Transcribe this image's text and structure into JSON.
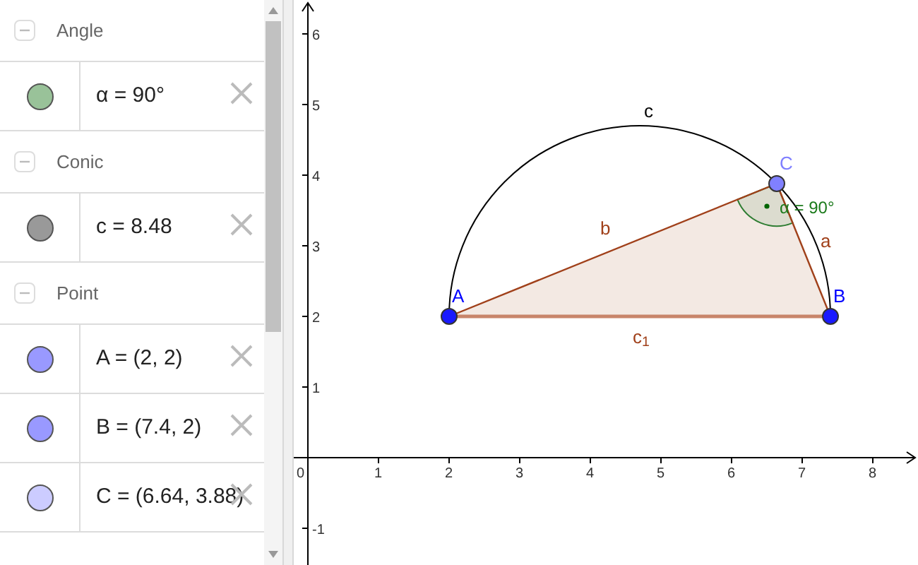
{
  "algebra": {
    "groups": [
      {
        "name": "Angle",
        "expanded": true,
        "items": [
          {
            "text": "α = 90°",
            "color": "#99c299"
          }
        ]
      },
      {
        "name": "Conic",
        "expanded": true,
        "items": [
          {
            "text": "c = 8.48",
            "color": "#999999"
          }
        ]
      },
      {
        "name": "Point",
        "expanded": true,
        "items": [
          {
            "text": "A = (2, 2)",
            "color": "#9999ff"
          },
          {
            "text": "B = (7.4, 2)",
            "color": "#9999ff"
          },
          {
            "text": "C = (6.64, 3.88)",
            "color": "#ccccff"
          }
        ]
      }
    ]
  },
  "graphics": {
    "x_ticks": [
      "0",
      "1",
      "2",
      "3",
      "4",
      "5",
      "6",
      "7",
      "8"
    ],
    "y_ticks": [
      "6",
      "5",
      "4",
      "3",
      "2",
      "1",
      "-1"
    ],
    "points": [
      {
        "label": "A"
      },
      {
        "label": "B"
      },
      {
        "label": "C"
      }
    ],
    "segments": [
      {
        "label": "a"
      },
      {
        "label": "b"
      },
      {
        "label": "c$_{1}$"
      }
    ],
    "arc_label": "c",
    "angle_label": "α = 90°"
  }
}
